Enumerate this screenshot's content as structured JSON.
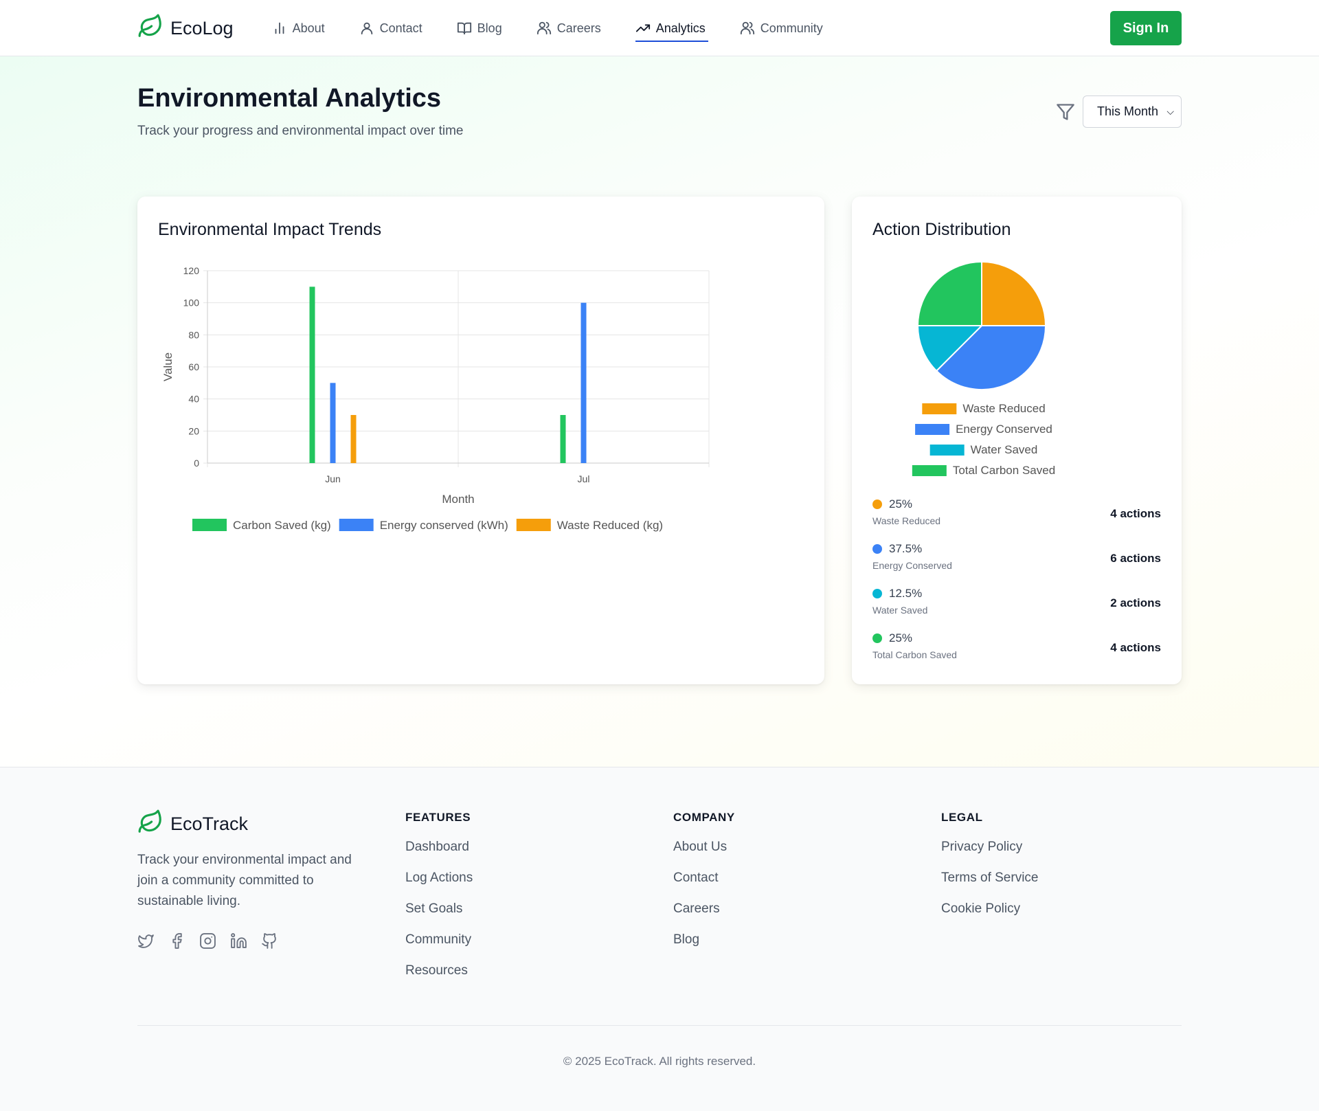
{
  "nav": {
    "brand": "EcoLog",
    "items": [
      {
        "label": "About",
        "icon": "bar-chart-icon",
        "active": false
      },
      {
        "label": "Contact",
        "icon": "user-icon",
        "active": false
      },
      {
        "label": "Blog",
        "icon": "book-icon",
        "active": false
      },
      {
        "label": "Careers",
        "icon": "users-icon",
        "active": false
      },
      {
        "label": "Analytics",
        "icon": "trending-up-icon",
        "active": true
      },
      {
        "label": "Community",
        "icon": "users-icon",
        "active": false
      }
    ],
    "sign_in_label": "Sign In"
  },
  "header": {
    "title": "Environmental Analytics",
    "subtitle": "Track your progress and environmental impact over time",
    "period_selected": "This Month"
  },
  "colors": {
    "brand_green": "#16a34a",
    "carbon": "#22c55e",
    "energy": "#3b82f6",
    "waste": "#f59e0b",
    "water": "#06b6d4"
  },
  "trend_card": {
    "title": "Environmental Impact Trends"
  },
  "distribution_card": {
    "title": "Action Distribution",
    "items": [
      {
        "pct": "25%",
        "name": "Waste Reduced",
        "count": "4 actions",
        "color": "#f59e0b"
      },
      {
        "pct": "37.5%",
        "name": "Energy Conserved",
        "count": "6 actions",
        "color": "#3b82f6"
      },
      {
        "pct": "12.5%",
        "name": "Water Saved",
        "count": "2 actions",
        "color": "#06b6d4"
      },
      {
        "pct": "25%",
        "name": "Total Carbon Saved",
        "count": "4 actions",
        "color": "#22c55e"
      }
    ]
  },
  "chart_data": [
    {
      "type": "bar",
      "title": "",
      "categories": [
        "Jun",
        "Jul"
      ],
      "xlabel": "Month",
      "ylabel": "Value",
      "ylim": [
        0,
        120
      ],
      "yticks": [
        0,
        20,
        40,
        60,
        80,
        100,
        120
      ],
      "grid": true,
      "legend": "bottom",
      "series": [
        {
          "name": "Carbon Saved (kg)",
          "values": [
            110,
            30
          ],
          "color": "#22c55e"
        },
        {
          "name": "Energy conserved (kWh)",
          "values": [
            50,
            100
          ],
          "color": "#3b82f6"
        },
        {
          "name": "Waste Reduced (kg)",
          "values": [
            30,
            0
          ],
          "color": "#f59e0b"
        }
      ]
    },
    {
      "type": "pie",
      "title": "",
      "labels": [
        "Waste Reduced",
        "Energy Conserved",
        "Water Saved",
        "Total Carbon Saved"
      ],
      "values": [
        4,
        6,
        2,
        4
      ],
      "colors": [
        "#f59e0b",
        "#3b82f6",
        "#06b6d4",
        "#22c55e"
      ],
      "legend": "bottom"
    }
  ],
  "footer": {
    "brand": "EcoTrack",
    "description": "Track your environmental impact and join a community committed to sustainable living.",
    "socials": [
      "twitter-icon",
      "facebook-icon",
      "instagram-icon",
      "linkedin-icon",
      "github-icon"
    ],
    "columns": [
      {
        "heading": "FEATURES",
        "links": [
          "Dashboard",
          "Log Actions",
          "Set Goals",
          "Community",
          "Resources"
        ]
      },
      {
        "heading": "COMPANY",
        "links": [
          "About Us",
          "Contact",
          "Careers",
          "Blog"
        ]
      },
      {
        "heading": "LEGAL",
        "links": [
          "Privacy Policy",
          "Terms of Service",
          "Cookie Policy"
        ]
      }
    ],
    "copyright": "© 2025 EcoTrack. All rights reserved."
  }
}
